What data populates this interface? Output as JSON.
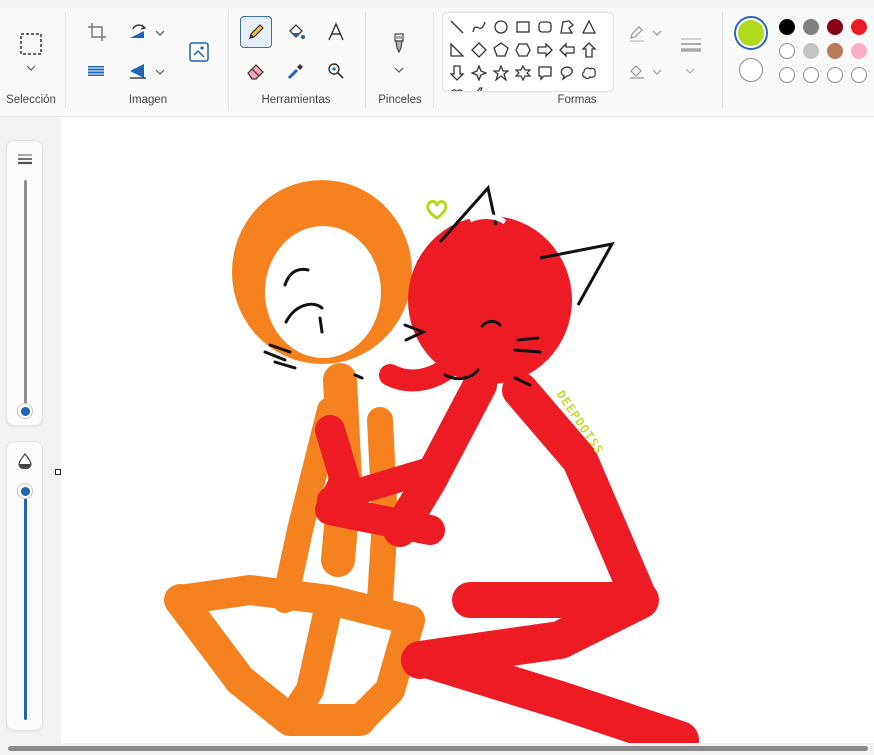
{
  "ribbon": {
    "groups": {
      "selection": "Selección",
      "image": "Imagen",
      "tools": "Herramientas",
      "brushes": "Pinceles",
      "shapes": "Formas"
    },
    "selection_tools": [
      "select-rectangle-icon"
    ],
    "image_tools": [
      "crop-icon",
      "rotate-icon",
      "resize-icon",
      "flip-icon",
      "image-generator-icon"
    ],
    "tools": [
      "pencil-icon",
      "fill-bucket-icon",
      "text-icon",
      "eraser-icon",
      "color-picker-icon",
      "magnifier-icon"
    ],
    "brush_icon": "brush-icon",
    "active_tool": "pencil"
  },
  "colors": {
    "primary": "#b3db1e",
    "secondary": "#ffffff",
    "palette_row1": [
      "#000000",
      "#7f7f7f",
      "#880015",
      "#ed1c24"
    ],
    "palette_row2": [
      "#ffffff",
      "#c3c3c3",
      "#b97a57",
      "#ffaec9"
    ],
    "palette_row3": [
      "",
      "",
      "",
      ""
    ]
  },
  "side_panel": {
    "size_icon": "stroke-size-icon",
    "opacity_icon": "opacity-drop-icon",
    "size_level": 0,
    "opacity_level": 1
  },
  "canvas": {
    "signature_text": "DEEPDOTSS",
    "drawing_description_colors": {
      "orange": "#f5821f",
      "red": "#ed1c24",
      "green": "#b3db1e"
    }
  }
}
